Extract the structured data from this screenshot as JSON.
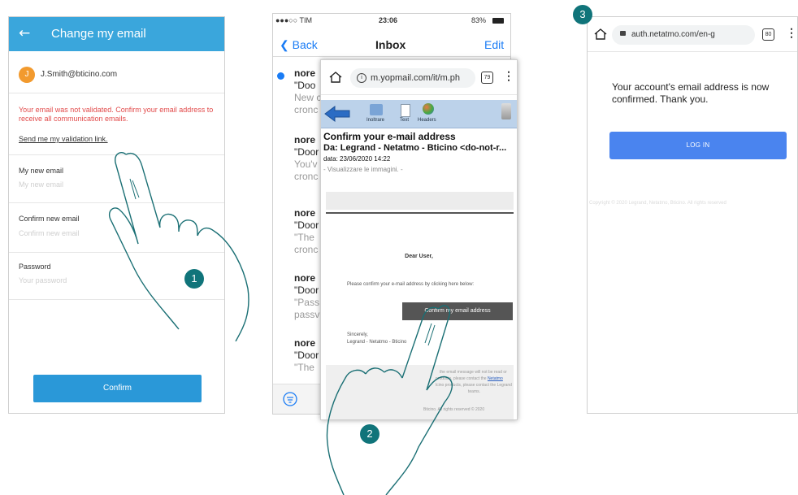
{
  "step_badges": [
    "1",
    "2",
    "3"
  ],
  "screen1": {
    "title": "Change my email",
    "back_icon": "arrow-left-icon",
    "avatar_initial": "J",
    "user_email": "J.Smith@bticino.com",
    "warning": "Your email was not validated. Confirm your email address to receive all communication emails.",
    "validation_link": "Send me my validation link.",
    "new_email_label": "My new email",
    "new_email_placeholder": "My new email",
    "confirm_email_label": "Confirm new email",
    "confirm_email_placeholder": "Confirm new email",
    "password_label": "Password",
    "password_placeholder": "Your password",
    "confirm_button": "Confirm",
    "colors": {
      "header": "#3aa6dc",
      "warning": "#e24b4b",
      "button": "#2a98d8",
      "avatar": "#f29a2e"
    }
  },
  "screen2_inbox": {
    "carrier": "●●●○○ TIM",
    "time": "23:06",
    "battery": "83%",
    "back_label": "Back",
    "title": "Inbox",
    "edit_label": "Edit",
    "messages": [
      {
        "sender": "nore",
        "line2": "\"Doo",
        "line3": "New c",
        "line4": "cronc"
      },
      {
        "sender": "nore",
        "line2": "\"Door",
        "line3": "You'v",
        "line4": "cronc"
      },
      {
        "sender": "nore",
        "line2": "\"Door",
        "line3": "\"The",
        "line4": "cronc"
      },
      {
        "sender": "nore",
        "line2": "\"Door",
        "line3": "\"Pass",
        "line4": "passv"
      },
      {
        "sender": "nore",
        "line2": "\"Door",
        "line3": "\"The",
        "line4": ""
      }
    ]
  },
  "screen2_mail": {
    "url": "m.yopmail.com/it/m.ph",
    "tab_count": "79",
    "toolbar": {
      "forward": "Inoltrare",
      "text": "Text",
      "headers": "Headers"
    },
    "subject": "Confirm your e-mail address",
    "from": "Da: Legrand - Netatmo - Bticino <do-not-r...",
    "date": "data: 23/06/2020 14:22",
    "show_images": "- Visualizzare le immagini. -",
    "greeting": "Dear User,",
    "instruction": "Please confirm your e-mail address by clicking here below:",
    "confirm_button": "Confirm my email address",
    "signoff_1": "Sincerely,",
    "signoff_2": "Legrand - Netatmo - Bticino",
    "footer_1": "the email message will not be read or",
    "footer_2": "products, please contact the",
    "footer_link": "Netatmo",
    "footer_3": "lcino products, please contact the Legrand",
    "footer_4": "teams.",
    "footer_5": "Bticino. All rights reserved © 2020"
  },
  "screen3": {
    "url": "auth.netatmo.com/en-g",
    "tab_count": "80",
    "message": "Your account's email address is now confirmed. Thank you.",
    "login_button": "LOG IN",
    "copyright": "Copyright © 2020 Legrand, Netatmo, Bticino. All rights reserved",
    "colors": {
      "button": "#4a84ef"
    }
  },
  "badge_color": "#10747a"
}
